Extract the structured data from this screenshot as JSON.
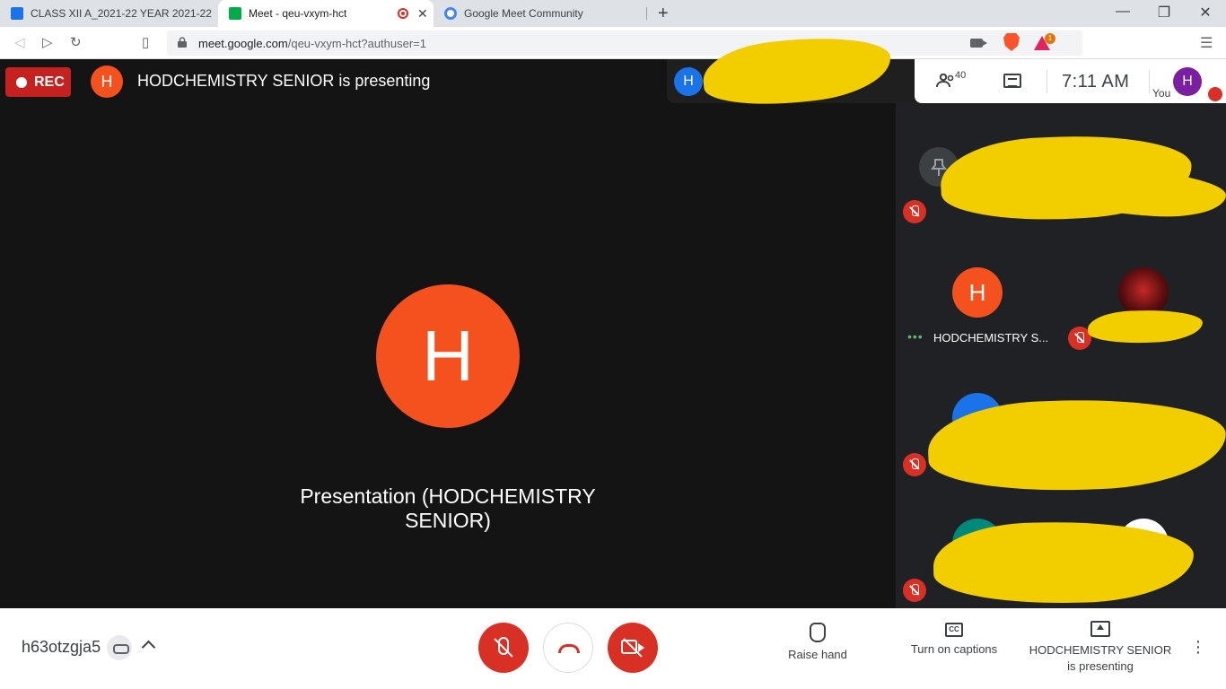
{
  "browser": {
    "tabs": [
      {
        "label": "CLASS XII A_2021-22 YEAR 2021-22"
      },
      {
        "label": "Meet - qeu-vxym-hct"
      },
      {
        "label": "Google Meet Community"
      }
    ],
    "new_tab_symbol": "+",
    "window_controls": {
      "minimize": "—",
      "restore": "❐",
      "close": "✕"
    },
    "url_host": "meet.google.com",
    "url_path": "/qeu-vxym-hct?authuser=1",
    "extension_badge": "1"
  },
  "meet": {
    "rec_label": "REC",
    "presenter_initial": "H",
    "presenting_title": "HODCHEMISTRY SENIOR is presenting",
    "mini_tile_initial": "H",
    "people_count": "40",
    "clock": "7:11  AM",
    "you_label": "You",
    "self_initial": "H",
    "main_avatar_initial": "H",
    "presentation_label": "Presentation (HODCHEMISTRY SENIOR)",
    "side_tiles": [
      {
        "initial": "H",
        "name": "HODCHEMISTRY S...",
        "color": "#f4511e"
      }
    ],
    "meeting_code": "h63otzgja5",
    "actions": {
      "raise_hand": "Raise hand",
      "captions": "Turn on captions",
      "presenting_line1": "HODCHEMISTRY SENIOR",
      "presenting_line2": "is presenting"
    },
    "icons": [
      "people-icon",
      "chat-icon",
      "mic-off-icon",
      "hangup-icon",
      "camera-off-icon",
      "hand-icon",
      "captions-icon",
      "present-icon",
      "more-icon"
    ],
    "colors": {
      "accent_red": "#d93025",
      "avatar_orange": "#f4511e",
      "self_purple": "#7b1fa2",
      "stage_bg": "#141414"
    }
  }
}
